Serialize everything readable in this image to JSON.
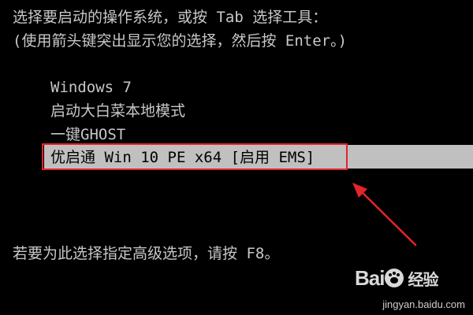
{
  "screen": {
    "header_line1": "选择要启动的操作系统，或按 Tab 选择工具：",
    "header_line2": "(使用箭头键突出显示您的选择，然后按 Enter。)",
    "menu_items": [
      "Windows 7",
      "启动大白菜本地模式",
      "一键GHOST"
    ],
    "selected_item": "优启通 Win 10 PE x64 [启用 EMS]",
    "footer_line": "若要为此选择指定高级选项，请按 F8。"
  },
  "watermark": {
    "logo_text": "Bai",
    "logo_text_2": "百",
    "logo_cn": "经验",
    "url": "jingyan.baidu.com"
  },
  "colors": {
    "background": "#000000",
    "text": "#c8c8c8",
    "selection_bar": "#c0c0c0",
    "annotation_red": "#e3242b"
  }
}
